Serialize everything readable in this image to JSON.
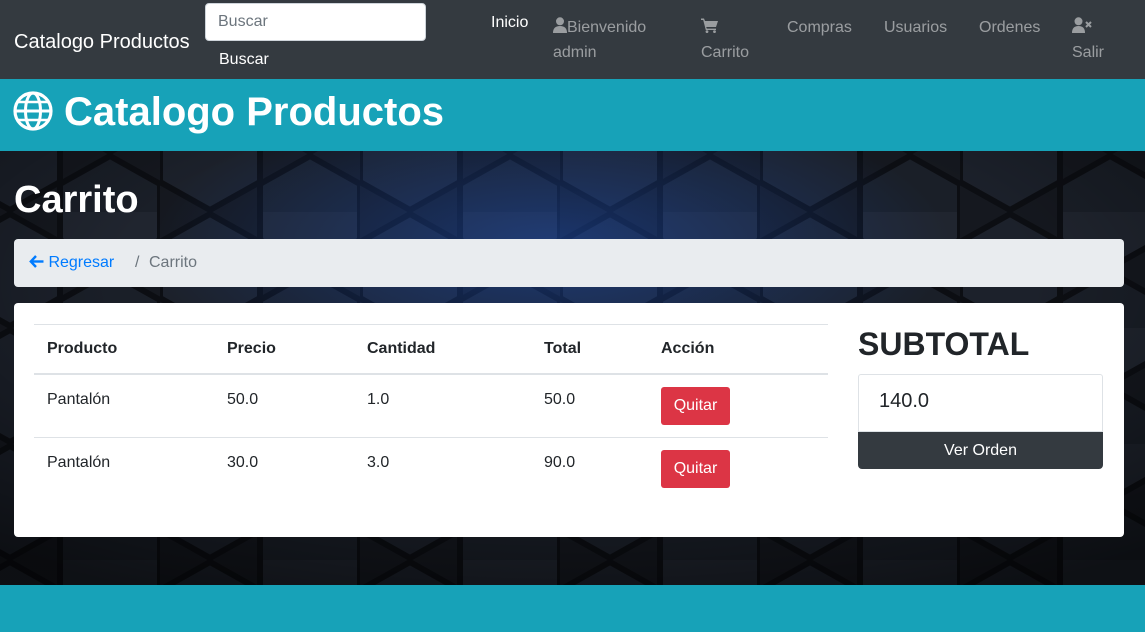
{
  "navbar": {
    "brand": "Catalogo Productos",
    "search": {
      "placeholder": "Buscar",
      "button_label": "Buscar"
    },
    "links": {
      "inicio": "Inicio",
      "user": "Bienvenido",
      "user_name": "admin",
      "carrito": "Carrito",
      "compras": "Compras",
      "usuarios": "Usuarios",
      "ordenes": "Ordenes",
      "salir": "Salir"
    }
  },
  "hero": {
    "title": "Catalogo Productos",
    "icon": "globe-icon"
  },
  "page": {
    "heading": "Carrito"
  },
  "breadcrumb": {
    "back_label": "Regresar",
    "separator": "/",
    "current": "Carrito"
  },
  "cart_table": {
    "headers": [
      "Producto",
      "Precio",
      "Cantidad",
      "Total",
      "Acción"
    ],
    "rows": [
      {
        "producto": "Pantalón",
        "precio": "50.0",
        "cantidad": "1.0",
        "total": "50.0",
        "action_label": "Quitar"
      },
      {
        "producto": "Pantalón",
        "precio": "30.0",
        "cantidad": "3.0",
        "total": "90.0",
        "action_label": "Quitar"
      }
    ]
  },
  "summary": {
    "title": "SUBTOTAL",
    "value": "140.0",
    "button_label": "Ver Orden"
  },
  "colors": {
    "navbar": "#343a40",
    "teal": "#17a2b8",
    "danger": "#dc3545",
    "link": "#007bff",
    "breadcrumb_bg": "#e9ecef"
  }
}
